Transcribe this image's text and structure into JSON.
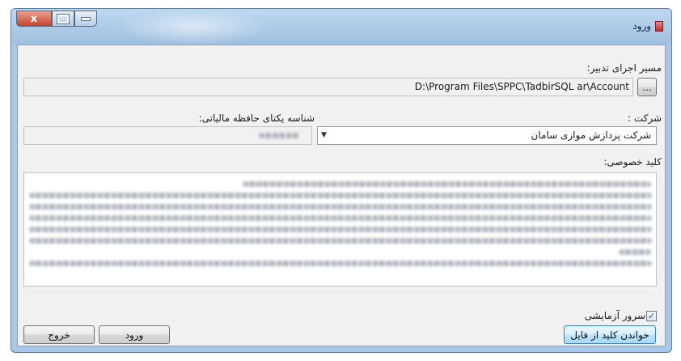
{
  "window": {
    "title": "ورود",
    "controls": {
      "close": "x",
      "maximize_icon": "maximize-icon",
      "minimize_icon": "minimize-icon"
    }
  },
  "path": {
    "label": "مسیر اجرای تدبیر:",
    "value": "D:\\Program Files\\SPPC\\TadbirSQL ar\\Account",
    "browse_label": "..."
  },
  "company": {
    "label": "شرکت :",
    "selected": "شرکت پردازش موازی سامان"
  },
  "memory_id": {
    "label": "شناسه یکتای حافظه مالیاتی:"
  },
  "private_key": {
    "label": "کلید خصوصی:"
  },
  "test_server": {
    "label": "سرور آزمایشی",
    "checked": true
  },
  "buttons": {
    "read_key": "خواندن کلید از فایل",
    "login": "ورود",
    "exit": "خروج"
  },
  "colors": {
    "title_bar": "#a9c8e6",
    "client_bg": "#f1f1f1",
    "close_button": "#c5432a",
    "primary_button": "#bee6fd"
  }
}
